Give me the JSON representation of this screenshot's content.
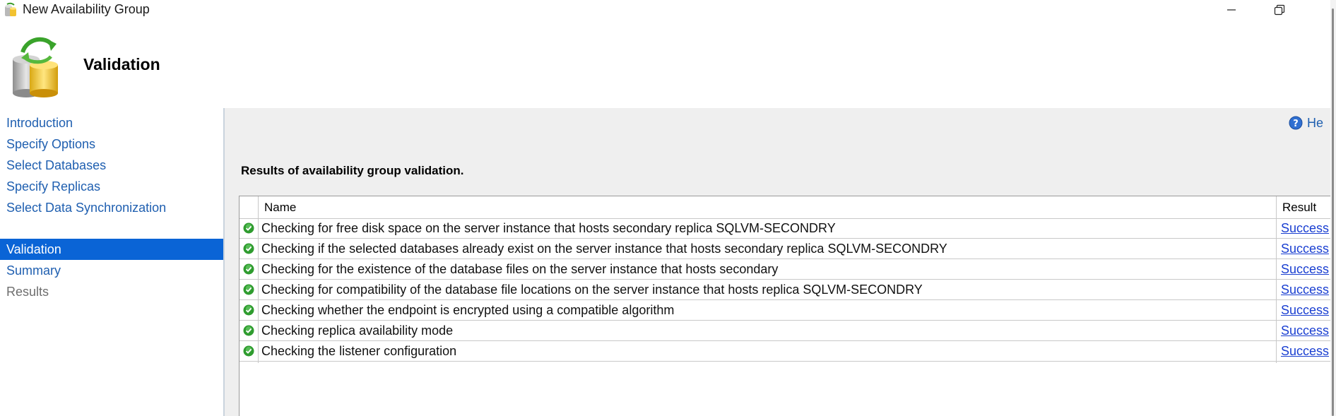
{
  "window": {
    "title": "New Availability Group",
    "icon": "app-database-icon"
  },
  "header": {
    "title": "Validation",
    "icon": "database-refresh-icon"
  },
  "nav": {
    "items": [
      {
        "label": "Introduction",
        "state": "link"
      },
      {
        "label": "Specify Options",
        "state": "link"
      },
      {
        "label": "Select Databases",
        "state": "link"
      },
      {
        "label": "Specify Replicas",
        "state": "link"
      },
      {
        "label": "Select Data Synchronization",
        "state": "link"
      },
      {
        "label": "Validation",
        "state": "active"
      },
      {
        "label": "Summary",
        "state": "link"
      },
      {
        "label": "Results",
        "state": "disabled"
      }
    ]
  },
  "help": {
    "label": "He",
    "icon": "help-icon"
  },
  "main": {
    "caption": "Results of availability group validation.",
    "columns": {
      "name": "Name",
      "result": "Result"
    },
    "rows": [
      {
        "name": "Checking for free disk space on the server instance that hosts secondary replica SQLVM-SECONDRY",
        "result": "Success",
        "icon": "success-check-icon"
      },
      {
        "name": "Checking if the selected databases already exist on the server instance that hosts secondary replica SQLVM-SECONDRY",
        "result": "Success",
        "icon": "success-check-icon"
      },
      {
        "name": "Checking for the existence of the database files on the server instance that hosts secondary",
        "result": "Success",
        "icon": "success-check-icon"
      },
      {
        "name": "Checking for compatibility of the database file locations on the server instance that hosts replica SQLVM-SECONDRY",
        "result": "Success",
        "icon": "success-check-icon"
      },
      {
        "name": "Checking whether the endpoint is encrypted using a compatible algorithm",
        "result": "Success",
        "icon": "success-check-icon"
      },
      {
        "name": "Checking replica availability mode",
        "result": "Success",
        "icon": "success-check-icon"
      },
      {
        "name": "Checking the listener configuration",
        "result": "Success",
        "icon": "success-check-icon"
      }
    ]
  },
  "colors": {
    "active_nav": "#0a64d6",
    "link": "#1f5fb0",
    "result_link": "#1a3fd1",
    "panel_bg": "#efefef"
  }
}
